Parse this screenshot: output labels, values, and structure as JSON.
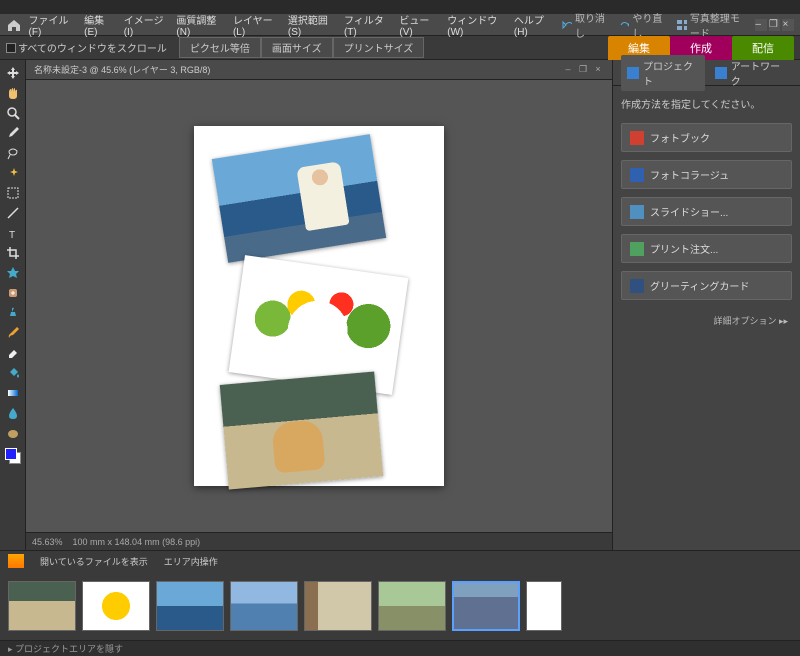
{
  "app": {
    "title": ""
  },
  "menu": {
    "items": [
      "ファイル(F)",
      "編集(E)",
      "イメージ(I)",
      "画質調整(N)",
      "レイヤー(L)",
      "選択範囲(S)",
      "フィルタ(T)",
      "ビュー(V)",
      "ウィンドウ(W)",
      "ヘルプ(H)"
    ],
    "undo": "取り消し",
    "redo": "やり直し",
    "organizer": "写真整理モード"
  },
  "options": {
    "scroll_all": "すべてのウィンドウをスクロール",
    "pixel": "ピクセル等倍",
    "fit": "画面サイズ",
    "print": "プリントサイズ"
  },
  "modes": {
    "edit": "編集",
    "create": "作成",
    "share": "配信"
  },
  "doc": {
    "title": "名称未設定-3 @ 45.6% (レイヤー 3, RGB/8)",
    "zoom": "45.63%",
    "dims": "100 mm x 148.04 mm (98.6 ppi)"
  },
  "panel": {
    "tab_project": "プロジェクト",
    "tab_artwork": "アートワーク",
    "hint": "作成方法を指定してください。",
    "items": [
      {
        "label": "フォトブック"
      },
      {
        "label": "フォトコラージュ"
      },
      {
        "label": "スライドショー..."
      },
      {
        "label": "プリント注文..."
      },
      {
        "label": "グリーティングカード"
      }
    ],
    "more": "詳細オプション  ▸▸"
  },
  "bin": {
    "open_files": "開いているファイルを表示",
    "area_ops": "エリア内操作"
  },
  "footer": {
    "hide": "▸ プロジェクトエリアを隠す"
  },
  "tools": [
    "move",
    "hand",
    "zoom",
    "eyedrop",
    "lasso",
    "wand",
    "marquee",
    "line",
    "type",
    "crop",
    "cookie",
    "heal",
    "clone",
    "brush",
    "erase",
    "bucket",
    "grad",
    "blur",
    "sponge"
  ],
  "window_controls": {
    "min": "–",
    "restore": "❐",
    "close": "×"
  }
}
